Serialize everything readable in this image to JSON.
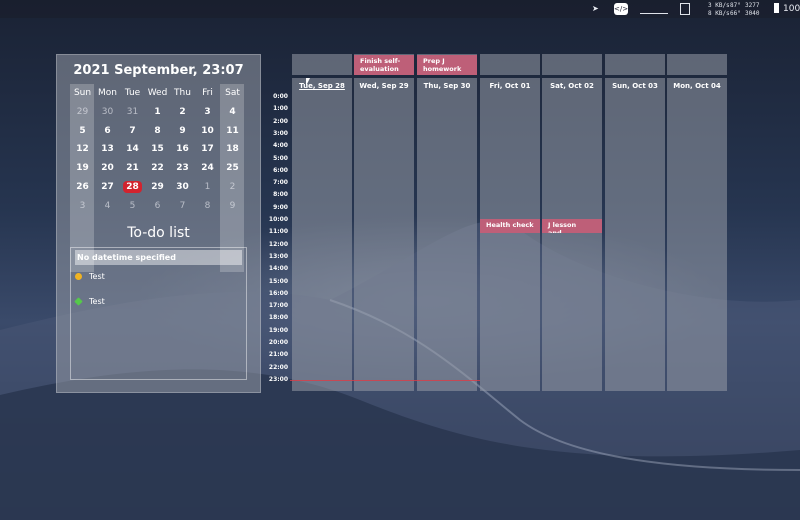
{
  "menubar": {
    "location_icon": "location-arrow-icon",
    "network_top": "3 KB/s",
    "network_bottom": "8 KB/s",
    "temp_top": "87°",
    "temp_bottom": "66°",
    "fan_top": "3277",
    "fan_bottom": "3040",
    "battery": "100"
  },
  "calendar": {
    "title": "2021 September, 23:07",
    "weekdays": [
      "Sun",
      "Mon",
      "Tue",
      "Wed",
      "Thu",
      "Fri",
      "Sat"
    ],
    "weeks": [
      [
        {
          "d": "29",
          "m": true
        },
        {
          "d": "30",
          "m": true
        },
        {
          "d": "31",
          "m": true
        },
        {
          "d": "1"
        },
        {
          "d": "2"
        },
        {
          "d": "3"
        },
        {
          "d": "4"
        }
      ],
      [
        {
          "d": "5"
        },
        {
          "d": "6"
        },
        {
          "d": "7"
        },
        {
          "d": "8"
        },
        {
          "d": "9"
        },
        {
          "d": "10"
        },
        {
          "d": "11"
        }
      ],
      [
        {
          "d": "12"
        },
        {
          "d": "13"
        },
        {
          "d": "14"
        },
        {
          "d": "15"
        },
        {
          "d": "16"
        },
        {
          "d": "17"
        },
        {
          "d": "18"
        }
      ],
      [
        {
          "d": "19"
        },
        {
          "d": "20"
        },
        {
          "d": "21"
        },
        {
          "d": "22"
        },
        {
          "d": "23"
        },
        {
          "d": "24"
        },
        {
          "d": "25"
        }
      ],
      [
        {
          "d": "26"
        },
        {
          "d": "27"
        },
        {
          "d": "28",
          "today": true
        },
        {
          "d": "29"
        },
        {
          "d": "30"
        },
        {
          "d": "1",
          "m": true
        },
        {
          "d": "2",
          "m": true
        }
      ],
      [
        {
          "d": "3",
          "m": true
        },
        {
          "d": "4",
          "m": true
        },
        {
          "d": "5",
          "m": true
        },
        {
          "d": "6",
          "m": true
        },
        {
          "d": "7",
          "m": true
        },
        {
          "d": "8",
          "m": true
        },
        {
          "d": "9",
          "m": true
        }
      ]
    ],
    "today_color": "#d2232e"
  },
  "todo": {
    "title": "To-do list",
    "section_header": "No datetime specified",
    "items": [
      {
        "label": "Test",
        "color": "#f0b323",
        "icon": "circle-dot-icon"
      },
      {
        "label": "Test",
        "color": "#55c94a",
        "icon": "diamond-dot-icon"
      }
    ]
  },
  "week": {
    "hours": [
      "0:00",
      "1:00",
      "2:00",
      "3:00",
      "4:00",
      "5:00",
      "6:00",
      "7:00",
      "8:00",
      "9:00",
      "10:00",
      "11:00",
      "12:00",
      "13:00",
      "14:00",
      "15:00",
      "16:00",
      "17:00",
      "18:00",
      "19:00",
      "20:00",
      "21:00",
      "22:00",
      "23:00"
    ],
    "days": [
      {
        "label": "Tue, Sep 28",
        "underline": true,
        "allday": ""
      },
      {
        "label": "Wed, Sep 29",
        "allday": "Finish self-evaluation"
      },
      {
        "label": "Thu, Sep 30",
        "allday": "Prep J homework"
      },
      {
        "label": "Fri, Oct 01",
        "allday": ""
      },
      {
        "label": "Sat, Oct 02",
        "allday": ""
      },
      {
        "label": "Sun, Oct 03",
        "allday": ""
      },
      {
        "label": "Mon, Oct 04",
        "allday": ""
      }
    ],
    "timed_events": [
      {
        "day_index": 3,
        "hour": 10,
        "label": "Health check"
      },
      {
        "day_index": 4,
        "hour": 10,
        "label": "J lesson and..."
      }
    ],
    "event_color": "#be5f78"
  }
}
